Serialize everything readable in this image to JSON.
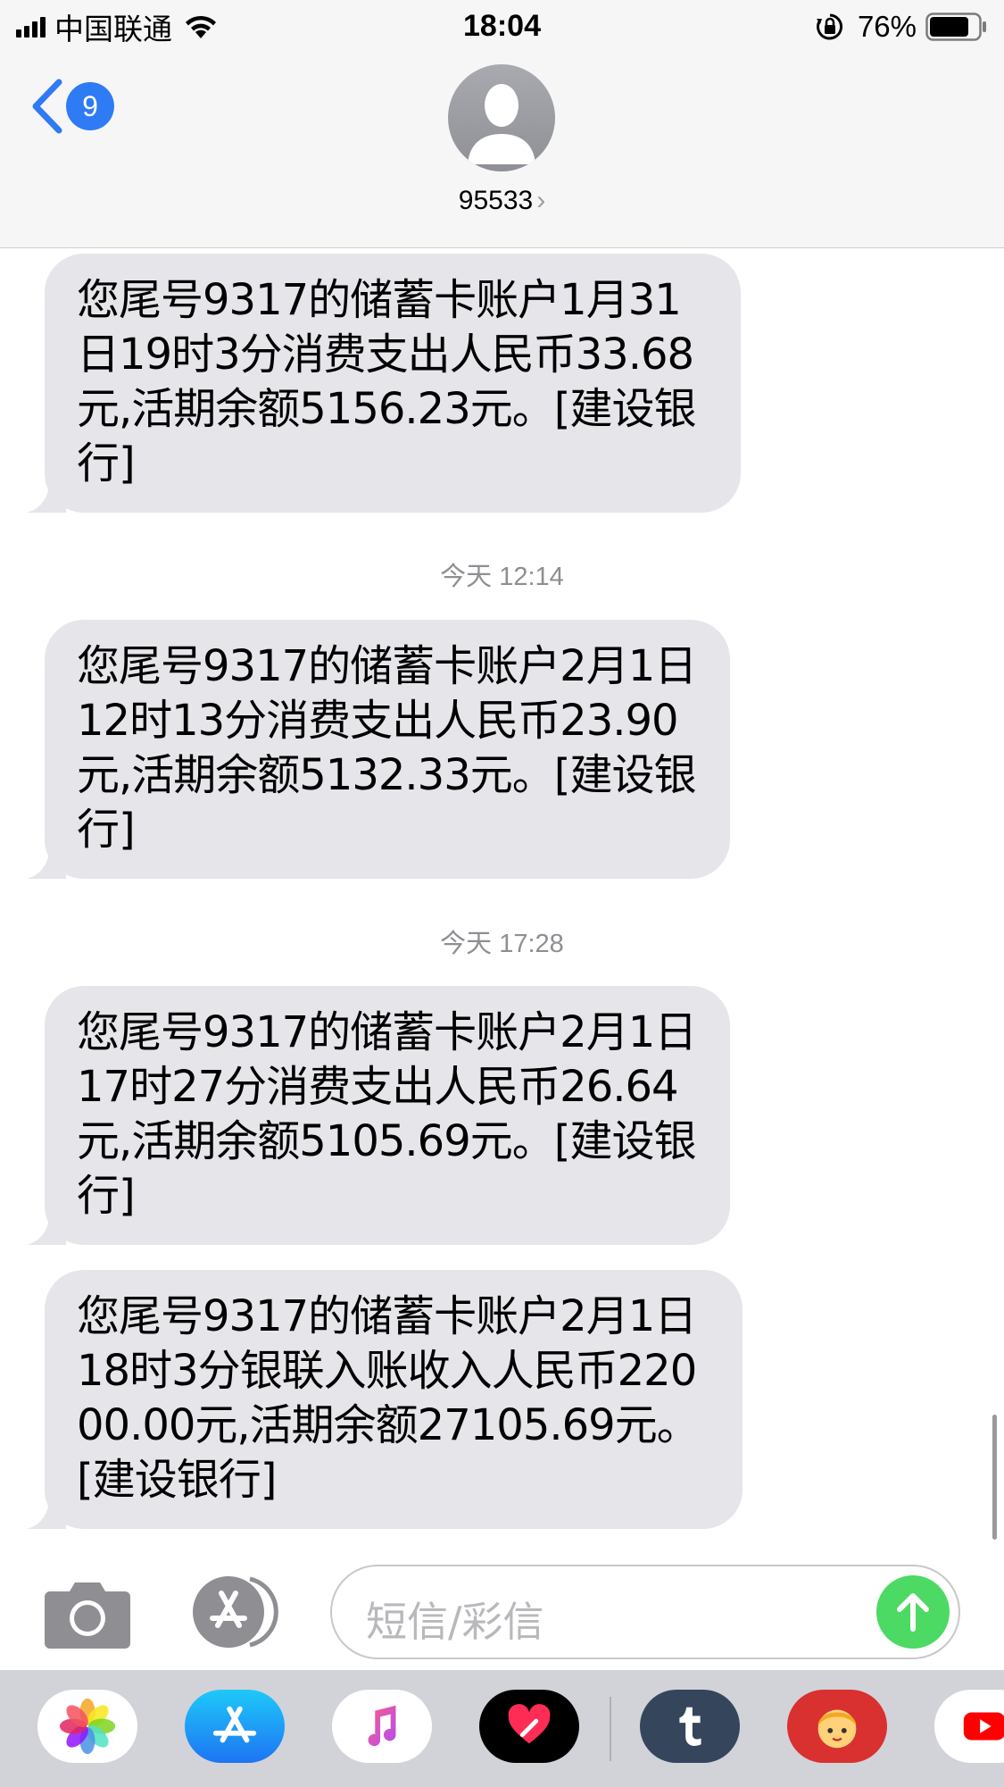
{
  "status_bar": {
    "carrier": "中国联通",
    "time": "18:04",
    "battery": "76%"
  },
  "header": {
    "back_badge": "9",
    "contact": "95533",
    "contact_chevron": "›"
  },
  "messages": [
    {
      "text": "您尾号9317的储蓄卡账户1月31日19时3分消费支出人民币33.68元,活期余额5156.23元。[建设银行]"
    },
    {
      "timestamp": "今天 12:14"
    },
    {
      "text": "您尾号9317的储蓄卡账户2月1日12时13分消费支出人民币23.90元,活期余额5132.33元。[建设银行]"
    },
    {
      "timestamp": "今天 17:28"
    },
    {
      "text": "您尾号9317的储蓄卡账户2月1日17时27分消费支出人民币26.64元,活期余额5105.69元。[建设银行]"
    },
    {
      "text": "您尾号9317的储蓄卡账户2月1日18时3分银联入账收入人民币22000.00元,活期余额27105.69元。[建设银行]"
    }
  ],
  "input": {
    "placeholder": "短信/彩信"
  },
  "icons": {
    "back": "chevron-left-icon",
    "avatar": "person-silhouette-icon",
    "camera": "camera-icon",
    "appstore": "app-store-icon",
    "send": "arrow-up-icon",
    "drawer": [
      "photos-icon",
      "app-store-icon",
      "music-icon",
      "digital-touch-icon",
      "tumblr-icon",
      "sticker-icon",
      "youtube-icon"
    ]
  },
  "colors": {
    "accent": "#2f7bf5",
    "bubble": "#e5e5ea",
    "send": "#4cd964"
  }
}
